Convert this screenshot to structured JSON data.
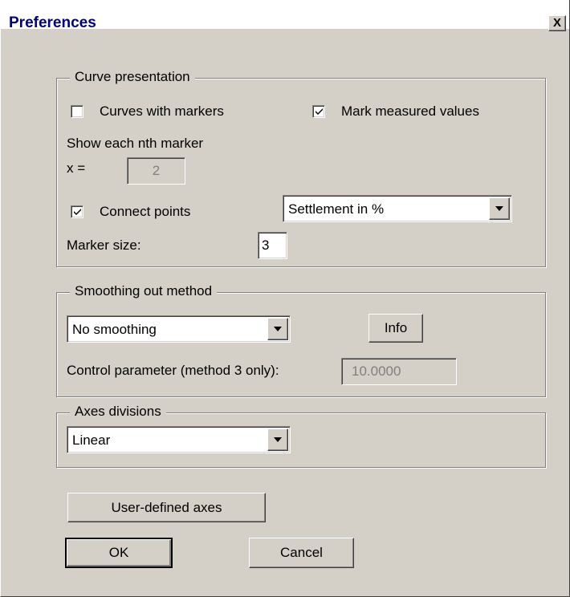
{
  "window": {
    "title": "Preferences",
    "close_label": "X"
  },
  "curve_presentation": {
    "legend": "Curve presentation",
    "curves_with_markers": {
      "label": "Curves with markers",
      "checked": false
    },
    "mark_measured_values": {
      "label": "Mark measured values",
      "checked": true
    },
    "show_each_nth_marker_label": "Show each nth marker",
    "x_label": "x =",
    "x_value": "2",
    "connect_points": {
      "label": "Connect points",
      "checked": true
    },
    "settlement_select": "Settlement in %",
    "marker_size_label": "Marker size:",
    "marker_size_value": "3"
  },
  "smoothing": {
    "legend": "Smoothing out method",
    "method_select": "No smoothing",
    "info_button": "Info",
    "control_parameter_label": "Control parameter (method 3 only):",
    "control_parameter_value": "10.0000"
  },
  "axes_divisions": {
    "legend": "Axes divisions",
    "select": "Linear"
  },
  "buttons": {
    "user_defined_axes": "User-defined axes",
    "ok": "OK",
    "cancel": "Cancel"
  }
}
